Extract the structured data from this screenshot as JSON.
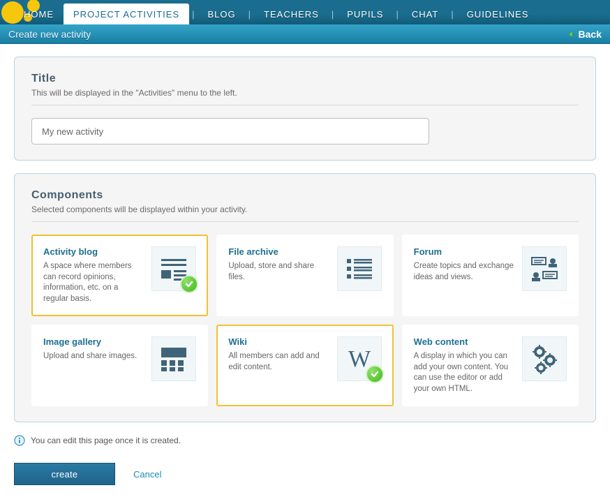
{
  "nav": {
    "items": [
      {
        "label": "HOME",
        "active": false
      },
      {
        "label": "PROJECT ACTIVITIES",
        "active": true
      },
      {
        "label": "BLOG",
        "active": false
      },
      {
        "label": "TEACHERS",
        "active": false
      },
      {
        "label": "PUPILS",
        "active": false
      },
      {
        "label": "CHAT",
        "active": false
      },
      {
        "label": "GUIDELINES",
        "active": false
      }
    ]
  },
  "header": {
    "title": "Create new activity",
    "back_label": "Back"
  },
  "title_section": {
    "heading": "Title",
    "sub": "This will be displayed in the \"Activities\" menu to the left.",
    "value": "My new activity"
  },
  "components_section": {
    "heading": "Components",
    "sub": "Selected components will be displayed within your activity.",
    "items": [
      {
        "title": "Activity blog",
        "desc": "A space where members can record opinions, information, etc. on a regular basis.",
        "selected": true,
        "icon": "blog"
      },
      {
        "title": "File archive",
        "desc": "Upload, store and share files.",
        "selected": false,
        "icon": "archive"
      },
      {
        "title": "Forum",
        "desc": "Create topics and exchange ideas and views.",
        "selected": false,
        "icon": "forum"
      },
      {
        "title": "Image gallery",
        "desc": "Upload and share images.",
        "selected": false,
        "icon": "gallery"
      },
      {
        "title": "Wiki",
        "desc": "All members can add and edit content.",
        "selected": true,
        "icon": "wiki"
      },
      {
        "title": "Web content",
        "desc": "A display in which you can add your own content. You can use the editor or add your own HTML.",
        "selected": false,
        "icon": "webcontent"
      }
    ]
  },
  "info_text": "You can edit this page once it is created.",
  "buttons": {
    "create": "create",
    "cancel": "Cancel"
  }
}
